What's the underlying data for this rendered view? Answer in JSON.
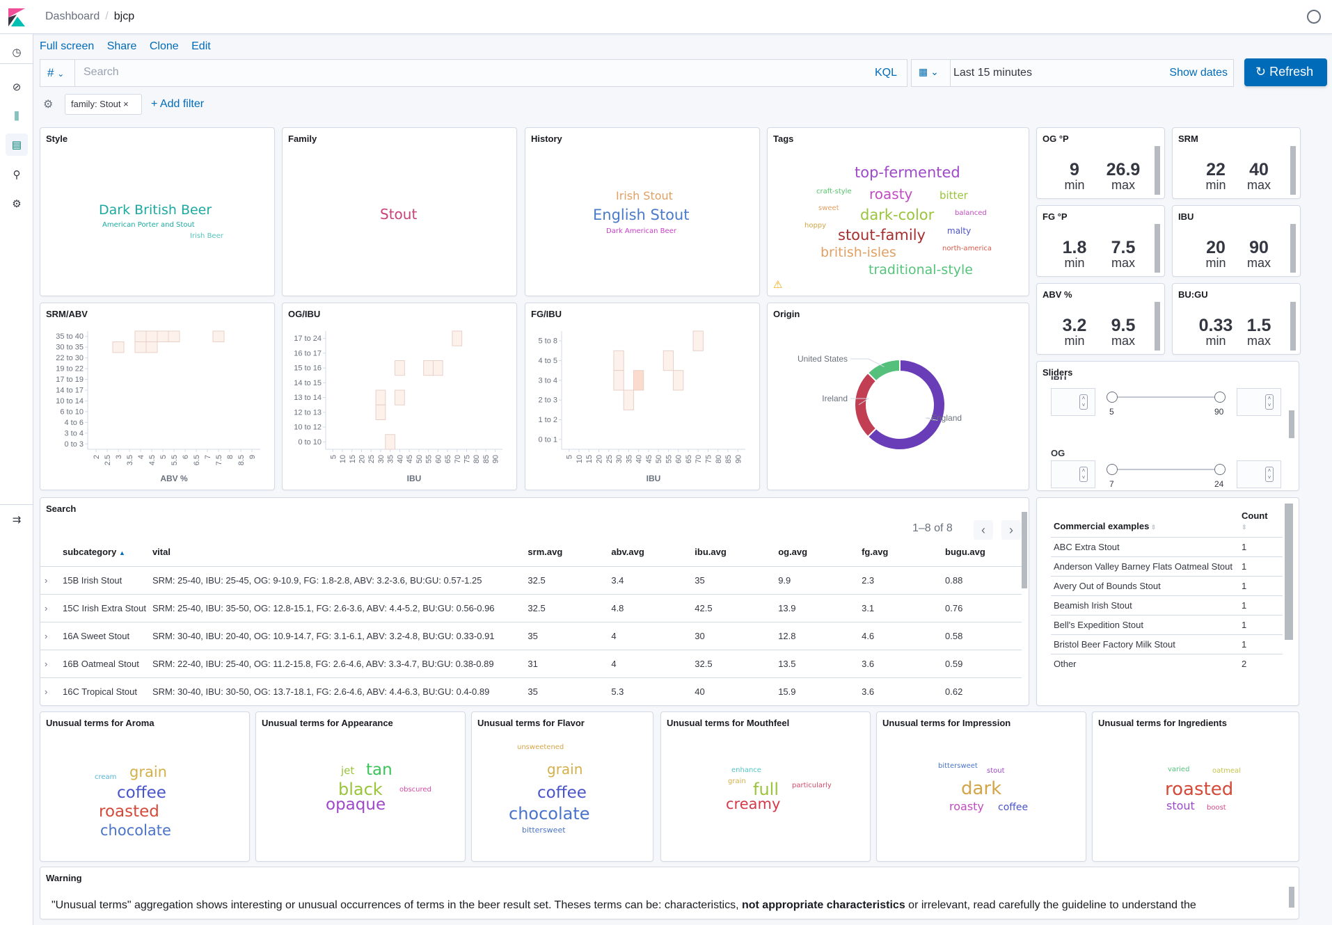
{
  "header": {
    "breadcrumb": [
      "Dashboard",
      "bjcp"
    ]
  },
  "sidenav": {
    "items": [
      "recent-icon",
      "discover-icon",
      "visualize-icon",
      "dashboard-icon",
      "dev-tools-icon",
      "management-icon"
    ],
    "collapse": "collapse-icon"
  },
  "actions": {
    "full_screen": "Full screen",
    "share": "Share",
    "clone": "Clone",
    "edit": "Edit"
  },
  "query": {
    "language_toggle": "#",
    "placeholder": "Search",
    "value": "",
    "kql": "KQL"
  },
  "time": {
    "range": "Last 15 minutes",
    "show_dates": "Show dates",
    "refresh": "Refresh"
  },
  "filters": {
    "items": [
      "family: Stout"
    ],
    "add": "+ Add filter"
  },
  "panels": {
    "style": {
      "title": "Style",
      "terms": [
        {
          "t": "Dark British Beer",
          "c": "#1ba9a0"
        },
        {
          "t": "American Porter and Stout",
          "c": "#1ba9a0"
        },
        {
          "t": "Irish Beer",
          "c": "#54c4b9"
        }
      ]
    },
    "family": {
      "title": "Family",
      "terms": [
        {
          "t": "Stout",
          "c": "#c9417a"
        }
      ]
    },
    "history": {
      "title": "History",
      "terms": [
        {
          "t": "Irish Stout",
          "c": "#e0a063"
        },
        {
          "t": "English Stout",
          "c": "#4a7bc9"
        },
        {
          "t": "Dark American Beer",
          "c": "#c83ec6"
        }
      ]
    },
    "tags": {
      "title": "Tags",
      "terms": [
        {
          "t": "top-fermented",
          "c": "#9e49c9"
        },
        {
          "t": "craft-style",
          "c": "#54c46b"
        },
        {
          "t": "roasty",
          "c": "#c04cc0"
        },
        {
          "t": "bitter",
          "c": "#9ac43c"
        },
        {
          "t": "sweet",
          "c": "#e0a063"
        },
        {
          "t": "dark-color",
          "c": "#9ac43c"
        },
        {
          "t": "balanced",
          "c": "#c04cc0"
        },
        {
          "t": "hoppy",
          "c": "#d4a548"
        },
        {
          "t": "stout-family",
          "c": "#a62e2e"
        },
        {
          "t": "malty",
          "c": "#4a54c9"
        },
        {
          "t": "british-isles",
          "c": "#e0a063"
        },
        {
          "t": "north-america",
          "c": "#d45a4a"
        },
        {
          "t": "traditional-style",
          "c": "#54c47b"
        }
      ],
      "warning_icon": "warning-icon"
    },
    "metrics": [
      {
        "title": "OG °P",
        "min": "9",
        "max": "26.9",
        "min_label": "min",
        "max_label": "max"
      },
      {
        "title": "SRM",
        "min": "22",
        "max": "40",
        "min_label": "min",
        "max_label": "max"
      },
      {
        "title": "FG °P",
        "min": "1.8",
        "max": "7.5",
        "min_label": "min",
        "max_label": "max"
      },
      {
        "title": "IBU",
        "min": "20",
        "max": "90",
        "min_label": "min",
        "max_label": "max"
      },
      {
        "title": "ABV %",
        "min": "3.2",
        "max": "9.5",
        "min_label": "min",
        "max_label": "max"
      },
      {
        "title": "BU:GU",
        "min": "0.33",
        "max": "1.5",
        "min_label": "min",
        "max_label": "max"
      }
    ],
    "sliders": {
      "title": "Sliders",
      "items": [
        {
          "label": "IBU",
          "min": "5",
          "max": "90"
        },
        {
          "label": "OG",
          "min": "7",
          "max": "24"
        }
      ]
    },
    "origin": {
      "title": "Origin"
    },
    "search": {
      "title": "Search",
      "pagination": "1–8 of 8",
      "columns": [
        "subcategory",
        "vital",
        "srm.avg",
        "abv.avg",
        "ibu.avg",
        "og.avg",
        "fg.avg",
        "bugu.avg"
      ],
      "rows": [
        [
          "15B Irish Stout",
          "SRM: 25-40, IBU: 25-45, OG: 9-10.9, FG: 1.8-2.8, ABV: 3.2-3.6, BU:GU: 0.57-1.25",
          "32.5",
          "3.4",
          "35",
          "9.9",
          "2.3",
          "0.88"
        ],
        [
          "15C Irish Extra Stout",
          "SRM: 25-40, IBU: 35-50, OG: 12.8-15.1, FG: 2.6-3.6, ABV: 4.4-5.2, BU:GU: 0.56-0.96",
          "32.5",
          "4.8",
          "42.5",
          "13.9",
          "3.1",
          "0.76"
        ],
        [
          "16A Sweet Stout",
          "SRM: 30-40, IBU: 20-40, OG: 10.9-14.7, FG: 3.1-6.1, ABV: 3.2-4.8, BU:GU: 0.33-0.91",
          "35",
          "4",
          "30",
          "12.8",
          "4.6",
          "0.58"
        ],
        [
          "16B Oatmeal Stout",
          "SRM: 22-40, IBU: 25-40, OG: 11.2-15.8, FG: 2.6-4.6, ABV: 3.3-4.7, BU:GU: 0.38-0.89",
          "31",
          "4",
          "32.5",
          "13.5",
          "3.6",
          "0.59"
        ],
        [
          "16C Tropical Stout",
          "SRM: 30-40, IBU: 30-50, OG: 13.7-18.1, FG: 2.6-4.6, ABV: 4.4-6.3, BU:GU: 0.4-0.89",
          "35",
          "5.3",
          "40",
          "15.9",
          "3.6",
          "0.62"
        ]
      ]
    },
    "commercial": {
      "columns": [
        "Commercial examples",
        "Count"
      ],
      "rows": [
        [
          "ABC Extra Stout",
          "1"
        ],
        [
          "Anderson Valley Barney Flats Oatmeal Stout",
          "1"
        ],
        [
          "Avery Out of Bounds Stout",
          "1"
        ],
        [
          "Beamish Irish Stout",
          "1"
        ],
        [
          "Bell's Expedition Stout",
          "1"
        ],
        [
          "Bristol Beer Factory Milk Stout",
          "1"
        ],
        [
          "Other",
          "2"
        ]
      ]
    },
    "unusual": [
      {
        "title": "Unusual terms for Aroma",
        "terms": [
          {
            "t": "grain",
            "c": "#d4b04a"
          },
          {
            "t": "cream",
            "c": "#54b4d4"
          },
          {
            "t": "coffee",
            "c": "#4a54c9"
          },
          {
            "t": "roasted",
            "c": "#d44a3a"
          },
          {
            "t": "chocolate",
            "c": "#4a74c9"
          }
        ]
      },
      {
        "title": "Unusual terms for Appearance",
        "terms": [
          {
            "t": "jet",
            "c": "#9ac43c"
          },
          {
            "t": "tan",
            "c": "#3ac45a"
          },
          {
            "t": "black",
            "c": "#9ac43c"
          },
          {
            "t": "obscured",
            "c": "#d44aa4"
          },
          {
            "t": "opaque",
            "c": "#9e49c9"
          }
        ]
      },
      {
        "title": "Unusual terms for Flavor",
        "terms": [
          {
            "t": "unsweetened",
            "c": "#d4a548"
          },
          {
            "t": "grain",
            "c": "#d4b04a"
          },
          {
            "t": "coffee",
            "c": "#4a54c9"
          },
          {
            "t": "chocolate",
            "c": "#4a74c9"
          },
          {
            "t": "bittersweet",
            "c": "#4a74c9"
          }
        ]
      },
      {
        "title": "Unusual terms for Mouthfeel",
        "terms": [
          {
            "t": "enhance",
            "c": "#54c4c4"
          },
          {
            "t": "grain",
            "c": "#d4b04a"
          },
          {
            "t": "full",
            "c": "#9ac43c"
          },
          {
            "t": "particularly",
            "c": "#d44a6a"
          },
          {
            "t": "creamy",
            "c": "#d43a4a"
          }
        ]
      },
      {
        "title": "Unusual terms for Impression",
        "terms": [
          {
            "t": "bittersweet",
            "c": "#4a74c9"
          },
          {
            "t": "stout",
            "c": "#9e49c9"
          },
          {
            "t": "dark",
            "c": "#d4a548"
          },
          {
            "t": "roasty",
            "c": "#c04cc0"
          },
          {
            "t": "coffee",
            "c": "#4a54c9"
          }
        ]
      },
      {
        "title": "Unusual terms for Ingredients",
        "terms": [
          {
            "t": "varied",
            "c": "#54c47b"
          },
          {
            "t": "oatmeal",
            "c": "#c4c44a"
          },
          {
            "t": "roasted",
            "c": "#d44a3a"
          },
          {
            "t": "stout",
            "c": "#9e49c9"
          },
          {
            "t": "boost",
            "c": "#d44a8a"
          }
        ]
      }
    ],
    "warning": {
      "title": "Warning",
      "text_pre": "\"Unusual terms\" aggregation shows interesting or unusual occurrences of terms in the beer result set. Theses terms can be: characteristics, ",
      "text_bold": "not appropriate characteristics",
      "text_post": " or irrelevant, read carefully the guideline to understand the"
    }
  },
  "chart_data": [
    {
      "type": "heatmap",
      "title": "SRM/ABV",
      "xlabel": "ABV %",
      "ylabel": "",
      "x": [
        "2",
        "2.5",
        "3",
        "3.5",
        "4",
        "4.5",
        "5",
        "5.5",
        "6",
        "6.5",
        "7",
        "7.5",
        "8",
        "8.5",
        "9"
      ],
      "y": [
        "0 to 3",
        "3 to 4",
        "4 to 6",
        "6 to 10",
        "10 to 14",
        "14 to 17",
        "17 to 19",
        "19 to 22",
        "22 to 30",
        "30 to 35",
        "35 to 40"
      ],
      "cells": [
        {
          "x": "4",
          "y": "35 to 40",
          "v": 1
        },
        {
          "x": "4.5",
          "y": "35 to 40",
          "v": 1
        },
        {
          "x": "5",
          "y": "35 to 40",
          "v": 1
        },
        {
          "x": "5.5",
          "y": "35 to 40",
          "v": 1
        },
        {
          "x": "7.5",
          "y": "35 to 40",
          "v": 1
        },
        {
          "x": "3",
          "y": "30 to 35",
          "v": 1
        },
        {
          "x": "4",
          "y": "30 to 35",
          "v": 1
        },
        {
          "x": "4.5",
          "y": "30 to 35",
          "v": 1
        }
      ]
    },
    {
      "type": "heatmap",
      "title": "OG/IBU",
      "xlabel": "IBU",
      "ylabel": "",
      "x": [
        "5",
        "10",
        "15",
        "20",
        "25",
        "30",
        "35",
        "40",
        "45",
        "50",
        "55",
        "60",
        "65",
        "70",
        "75",
        "80",
        "85",
        "90"
      ],
      "y": [
        "0 to 10",
        "10 to 12",
        "12 to 13",
        "13 to 14",
        "14 to 15",
        "15 to 16",
        "16 to 17",
        "17 to 24"
      ],
      "cells": [
        {
          "x": "70",
          "y": "17 to 24",
          "v": 1
        },
        {
          "x": "40",
          "y": "15 to 16",
          "v": 1
        },
        {
          "x": "55",
          "y": "15 to 16",
          "v": 1
        },
        {
          "x": "60",
          "y": "15 to 16",
          "v": 1
        },
        {
          "x": "30",
          "y": "13 to 14",
          "v": 1
        },
        {
          "x": "40",
          "y": "13 to 14",
          "v": 1
        },
        {
          "x": "30",
          "y": "12 to 13",
          "v": 1
        },
        {
          "x": "35",
          "y": "0 to 10",
          "v": 1
        }
      ]
    },
    {
      "type": "heatmap",
      "title": "FG/IBU",
      "xlabel": "IBU",
      "ylabel": "",
      "x": [
        "5",
        "10",
        "15",
        "20",
        "25",
        "30",
        "35",
        "40",
        "45",
        "50",
        "55",
        "60",
        "65",
        "70",
        "75",
        "80",
        "85",
        "90"
      ],
      "y": [
        "0 to 1",
        "1 to 2",
        "2 to 3",
        "3 to 4",
        "4 to 5",
        "5 to 8"
      ],
      "cells": [
        {
          "x": "70",
          "y": "5 to 8",
          "v": 1
        },
        {
          "x": "30",
          "y": "4 to 5",
          "v": 1
        },
        {
          "x": "55",
          "y": "4 to 5",
          "v": 1
        },
        {
          "x": "30",
          "y": "3 to 4",
          "v": 1
        },
        {
          "x": "40",
          "y": "3 to 4",
          "v": 2
        },
        {
          "x": "60",
          "y": "3 to 4",
          "v": 1
        },
        {
          "x": "35",
          "y": "2 to 3",
          "v": 1
        }
      ]
    },
    {
      "type": "pie",
      "title": "Origin",
      "donut": true,
      "slices": [
        {
          "label": "England",
          "value": 5,
          "color": "#6a3db8"
        },
        {
          "label": "Ireland",
          "value": 2,
          "color": "#c23e52"
        },
        {
          "label": "United States",
          "value": 1,
          "color": "#54c07b"
        }
      ]
    }
  ]
}
